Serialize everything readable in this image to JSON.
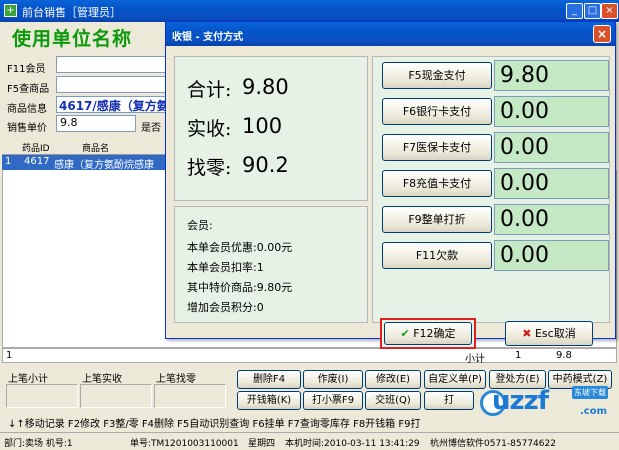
{
  "window": {
    "title": "前台销售［管理员］"
  },
  "store": {
    "name": "使用单位名称"
  },
  "left_form": {
    "member_label": "F11会员",
    "lookup_label": "F5查商品",
    "product_info_label": "商品信息",
    "product_info_value": "4617/感康（复方氨",
    "unit_price_label": "销售单价",
    "unit_price_value": "9.8",
    "is_label": "是否"
  },
  "grid": {
    "columns": [
      "药品ID",
      "商品名"
    ],
    "row": {
      "index": "1",
      "id": "4617",
      "name": "感康（复方氨酚烷感康"
    }
  },
  "summary": {
    "index": "1",
    "subtotal_label": "小计",
    "qty": "1",
    "amount": "9.8"
  },
  "previous": {
    "subtotal_label": "上笔小计",
    "paid_label": "上笔实收",
    "change_label": "上笔找零"
  },
  "buttons": {
    "delete": "删除F4",
    "void": "作废(I)",
    "modify": "修改(E)",
    "custom_order": "自定义单(P)",
    "prescription": "登处方(E)",
    "herbal_mode": "中药模式(Z)",
    "open_drawer": "开钱箱(K)",
    "print_ticket": "打小票F9",
    "shift": "交班(Q)",
    "print": "打"
  },
  "shortcuts": "↓↑移动记录 F2修改 F3整/零 F4删除 F5自动识别查询 F6挂单 F7查询零库存 F8开钱箱 F9打",
  "status": {
    "dept": "部门:卖场 机号:1",
    "order_no": "单号:TM1201003110001",
    "weekday": "星期四",
    "time": "本机时间:2010-03-11 13:41:29",
    "vendor": "杭州博信软件0571-85774622"
  },
  "dialog": {
    "title": "收银 - 支付方式",
    "total_label": "合计:",
    "total_value": "9.80",
    "received_label": "实收:",
    "received_value": "100",
    "change_label": "找零:",
    "change_value": "90.2",
    "member_header": "会员:",
    "member_discount": "本单会员优惠:0.00元",
    "member_rate": "本单会员扣率:1",
    "special_items": "其中特价商品:9.80元",
    "add_points": "增加会员积分:0",
    "payments": [
      {
        "label": "F5现金支付",
        "amount": "9.80"
      },
      {
        "label": "F6银行卡支付",
        "amount": "0.00"
      },
      {
        "label": "F7医保卡支付",
        "amount": "0.00"
      },
      {
        "label": "F8充值卡支付",
        "amount": "0.00"
      },
      {
        "label": "F9整单打折",
        "amount": "0.00"
      },
      {
        "label": "F11欠款",
        "amount": "0.00"
      }
    ],
    "confirm_label": "F12确定",
    "cancel_label": "Esc取消"
  },
  "watermark": {
    "logo": "uzzf",
    "tag": "东坡下载",
    "site": ".com"
  }
}
